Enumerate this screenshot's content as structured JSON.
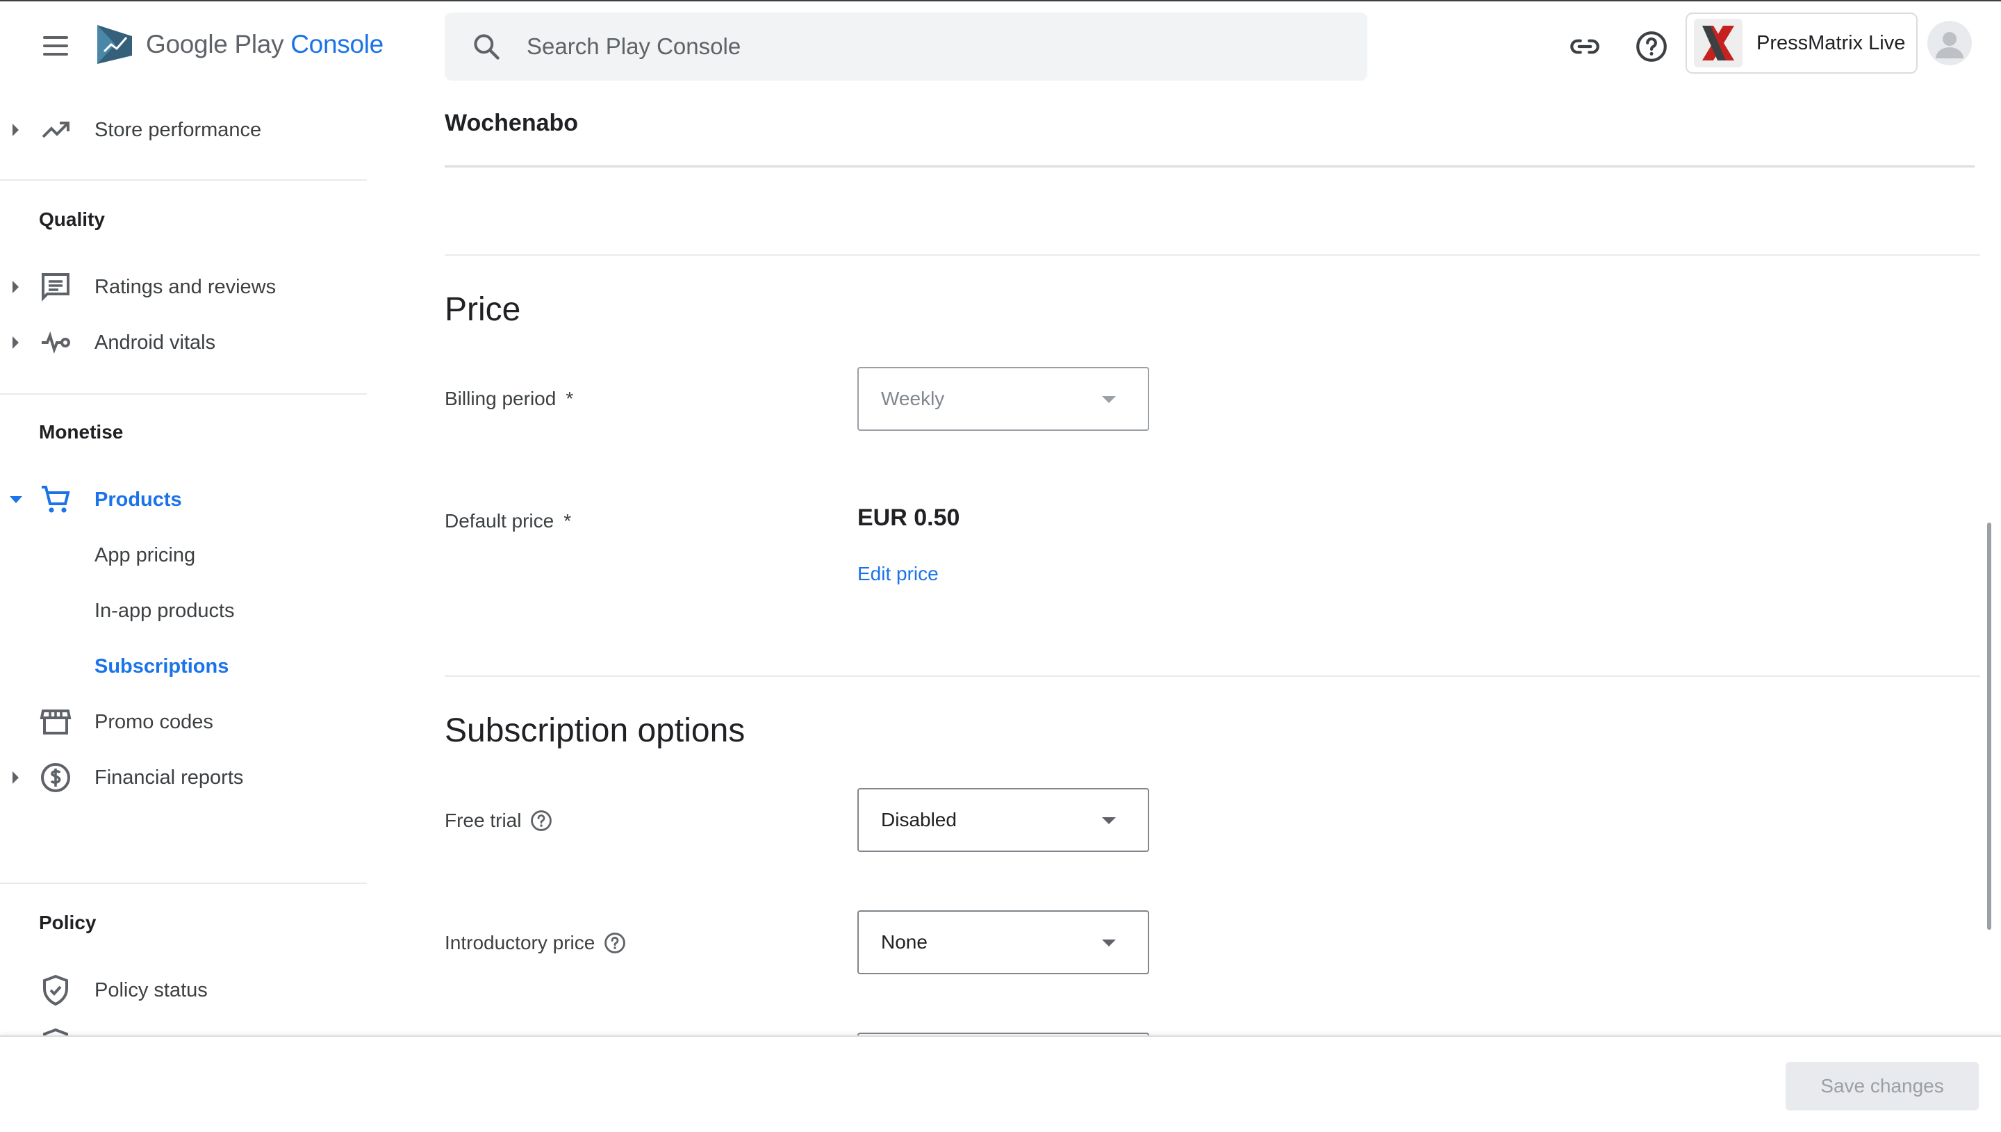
{
  "app": {
    "brand_google": "Google Play",
    "brand_console": "Console"
  },
  "search": {
    "placeholder": "Search Play Console"
  },
  "account": {
    "name": "PressMatrix Live"
  },
  "sidebar": {
    "items": [
      {
        "label": "Store performance"
      },
      {
        "label": "Ratings and reviews"
      },
      {
        "label": "Android vitals"
      },
      {
        "label": "Products"
      },
      {
        "label": "App pricing"
      },
      {
        "label": "In-app products"
      },
      {
        "label": "Subscriptions"
      },
      {
        "label": "Promo codes"
      },
      {
        "label": "Financial reports"
      },
      {
        "label": "Policy status"
      }
    ],
    "sections": {
      "quality": "Quality",
      "monetise": "Monetise",
      "policy": "Policy"
    }
  },
  "main": {
    "product_name": "Wochenabo",
    "price_section": {
      "title": "Price",
      "billing_period_label": "Billing period",
      "billing_period_value": "Weekly",
      "default_price_label": "Default price",
      "default_price_value": "EUR 0.50",
      "edit_price_link": "Edit price",
      "required_mark": "*"
    },
    "subscription_options": {
      "title": "Subscription options",
      "free_trial_label": "Free trial",
      "free_trial_value": "Disabled",
      "intro_price_label": "Introductory price",
      "intro_price_value": "None"
    }
  },
  "footer": {
    "save_label": "Save changes"
  },
  "colors": {
    "accent": "#1a73e8",
    "text": "#202124",
    "muted": "#5f6368",
    "brand_x": "#c5221f"
  }
}
